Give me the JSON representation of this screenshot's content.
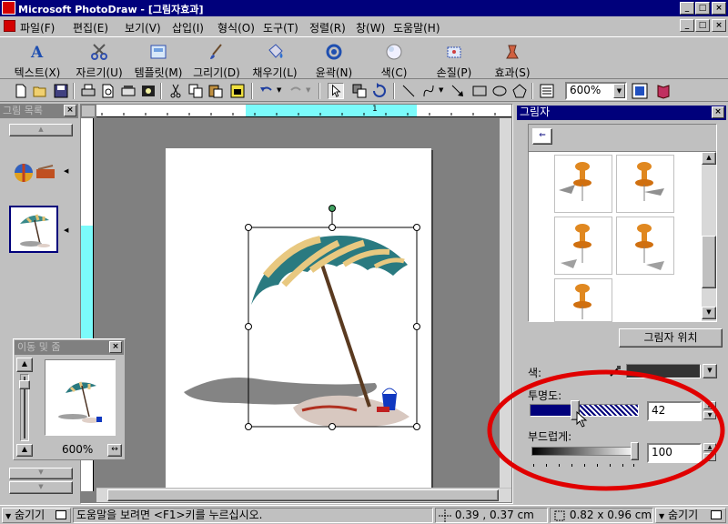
{
  "window": {
    "title": "Microsoft PhotoDraw - [그림자효과]",
    "minimize": "_",
    "restore": "□",
    "close": "×"
  },
  "menu": [
    "파일(F)",
    "편집(E)",
    "보기(V)",
    "삽입(I)",
    "형식(O)",
    "도구(T)",
    "정렬(R)",
    "창(W)",
    "도움말(H)"
  ],
  "big_toolbar": [
    {
      "label": "텍스트(X)",
      "icon": "text-icon"
    },
    {
      "label": "자르기(U)",
      "icon": "scissors-icon"
    },
    {
      "label": "템플릿(M)",
      "icon": "template-icon"
    },
    {
      "label": "그리기(D)",
      "icon": "brush-icon"
    },
    {
      "label": "채우기(L)",
      "icon": "paint-bucket-icon"
    },
    {
      "label": "윤곽(N)",
      "icon": "outline-icon"
    },
    {
      "label": "색(C)",
      "icon": "color-icon"
    },
    {
      "label": "손질(P)",
      "icon": "touchup-icon"
    },
    {
      "label": "효과(S)",
      "icon": "effects-icon"
    }
  ],
  "std_toolbar": {
    "zoom": "600%"
  },
  "picture_list": {
    "title": "그림 목록"
  },
  "pan_zoom": {
    "title": "이동 및 줌",
    "zoom": "600%"
  },
  "ruler": {
    "mark": "1"
  },
  "shadow_panel": {
    "title": "그림자",
    "position_button": "그림자 위치",
    "color_label": "색:",
    "transparency_label": "투명도:",
    "transparency_value": "42",
    "softness_label": "부드럽게:",
    "softness_value": "100",
    "transparency_level": 42,
    "softness_level": 100,
    "shadow_color": "#333333"
  },
  "status": {
    "hide_left": "숨기기",
    "help_text": "도움말을 보려면 <F1>키를 누르십시오.",
    "position": "0.39 , 0.37 cm",
    "size": "0.82 x 0.96 cm",
    "hide_right": "숨기기"
  },
  "colors": {
    "title_bar": "#00007b",
    "selection_fill": "#7bfbfb",
    "annotation_ellipse": "#e00000"
  }
}
